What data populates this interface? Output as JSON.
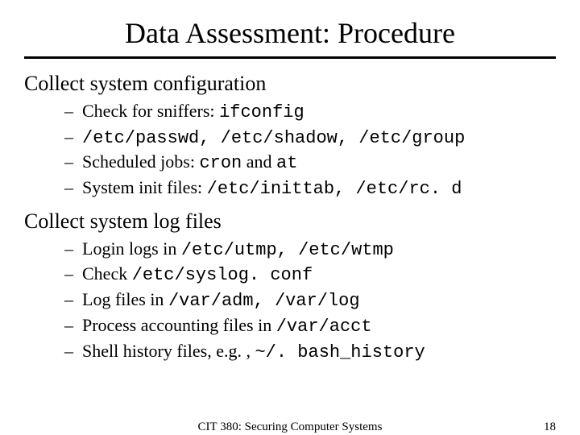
{
  "title": "Data Assessment: Procedure",
  "section1": {
    "heading": "Collect system configuration",
    "items": {
      "i0": {
        "pre": "Check for sniffers: ",
        "code": "ifconfig"
      },
      "i1": {
        "code": "/etc/passwd, /etc/shadow, /etc/group"
      },
      "i2": {
        "pre": "Scheduled jobs: ",
        "code1": "cron",
        "mid": " and ",
        "code2": "at"
      },
      "i3": {
        "pre": "System init files: ",
        "code": "/etc/inittab, /etc/rc. d"
      }
    }
  },
  "section2": {
    "heading": "Collect system log files",
    "items": {
      "i0": {
        "pre": "Login logs in ",
        "code": "/etc/utmp, /etc/wtmp"
      },
      "i1": {
        "pre": "Check ",
        "code": "/etc/syslog. conf"
      },
      "i2": {
        "pre": "Log files in ",
        "code": "/var/adm, /var/log"
      },
      "i3": {
        "pre": "Process accounting files in ",
        "code": "/var/acct"
      },
      "i4": {
        "pre": "Shell history files, e.g. , ",
        "code": "~/. bash_history"
      }
    }
  },
  "footer": {
    "course": "CIT 380: Securing Computer Systems",
    "page": "18"
  },
  "dash": "–"
}
